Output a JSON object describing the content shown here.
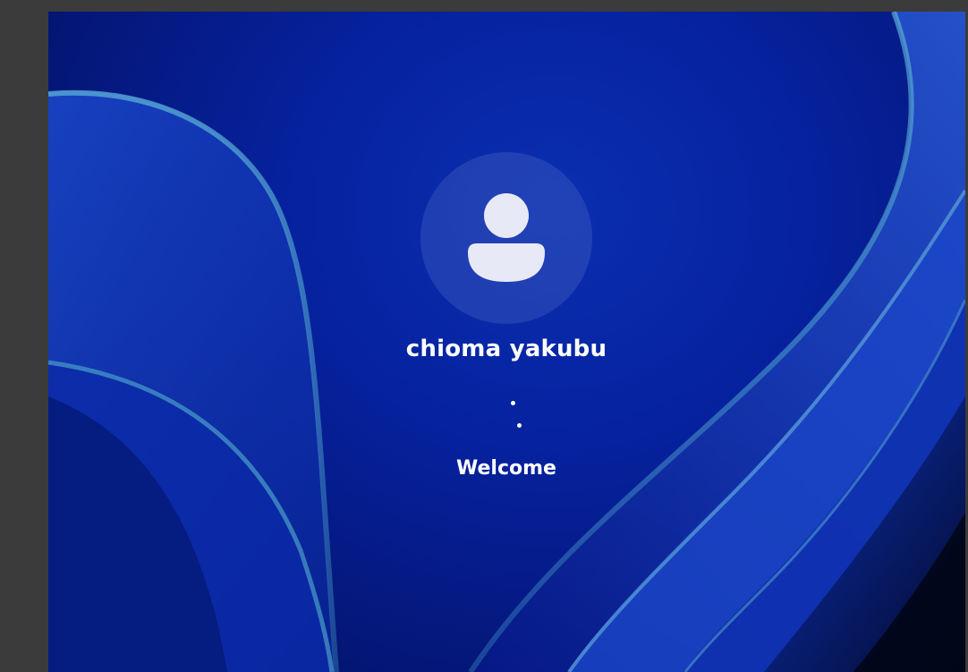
{
  "login_screen": {
    "user_name": "chioma yakubu",
    "status_text": "Welcome",
    "avatar_icon": "user-avatar-icon",
    "spinner_icon": "loading-spinner-icon"
  },
  "colors": {
    "vm_frame": "#3b3b3b",
    "wallpaper_base": "#0622a0",
    "text": "#ffffff",
    "avatar_glyph": "#e8e9f6"
  }
}
